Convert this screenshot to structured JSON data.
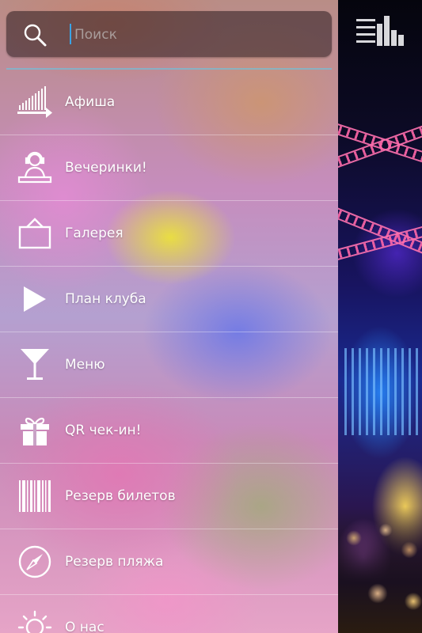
{
  "search": {
    "placeholder": "Поиск"
  },
  "menu": {
    "items": [
      {
        "label": "Афиша",
        "icon": "events-arrow-icon"
      },
      {
        "label": "Вечеринки!",
        "icon": "dj-icon"
      },
      {
        "label": "Галерея",
        "icon": "picture-frame-icon"
      },
      {
        "label": "План клуба",
        "icon": "play-icon"
      },
      {
        "label": "Меню",
        "icon": "cocktail-glass-icon"
      },
      {
        "label": "QR чек-ин!",
        "icon": "gift-icon"
      },
      {
        "label": "Резерв билетов",
        "icon": "barcode-icon"
      },
      {
        "label": "Резерв пляжа",
        "icon": "compass-icon"
      },
      {
        "label": "О нас",
        "icon": "sun-icon"
      }
    ]
  },
  "colors": {
    "accent": "#39a3e6",
    "menu_text": "#ffffff"
  }
}
